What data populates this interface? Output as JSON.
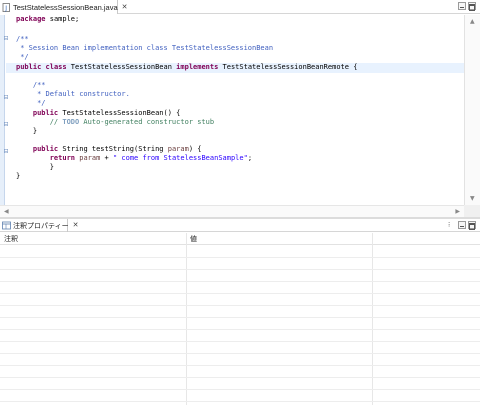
{
  "editor": {
    "tab_label": "TestStatelessSessionBean.java",
    "tab_close": "✕",
    "code": {
      "l1_kw": "package",
      "l1_rest": " sample;",
      "l3": "/**",
      "l4": " * Session Bean implementation class TestStatelessSessionBean",
      "l5": " */",
      "l6_kw1": "public",
      "l6_sp1": " ",
      "l6_kw2": "class",
      "l6_mid": " TestStatelessSessionBean ",
      "l6_kw3": "implements",
      "l6_rest": " TestStatelessSessionBeanRemote {",
      "l8": "    /**",
      "l9": "     * Default constructor.",
      "l10": "     */",
      "l11_kw": "    public",
      "l11_rest": " TestStatelessSessionBean() {",
      "l12_pre": "        // ",
      "l12_todo": "TODO",
      "l12_rest": " Auto-generated constructor stub",
      "l13": "    }",
      "l15_kw": "    public",
      "l15_mid": " String testString(String ",
      "l15_param": "param",
      "l15_rest": ") {",
      "l16_kw": "        return",
      "l16_sp": " ",
      "l16_param": "param",
      "l16_plus": " + ",
      "l16_str": "\" come from StatelessBeanSample\"",
      "l16_end": ";",
      "l17": "        }",
      "l18": "}"
    },
    "fold_markers": [
      "⊟",
      "⊟",
      "⊟",
      "⊟"
    ]
  },
  "properties": {
    "tab_label": "注釈プロパティー",
    "tab_close": "✕",
    "menu": "⁝",
    "columns": [
      "注釈",
      "値"
    ]
  },
  "colors": {
    "keyword": "#7f0055",
    "javadoc": "#3f5fbf",
    "line_comment": "#3f7f5f",
    "string": "#2a00ff",
    "current_line": "#e8f2fe"
  }
}
